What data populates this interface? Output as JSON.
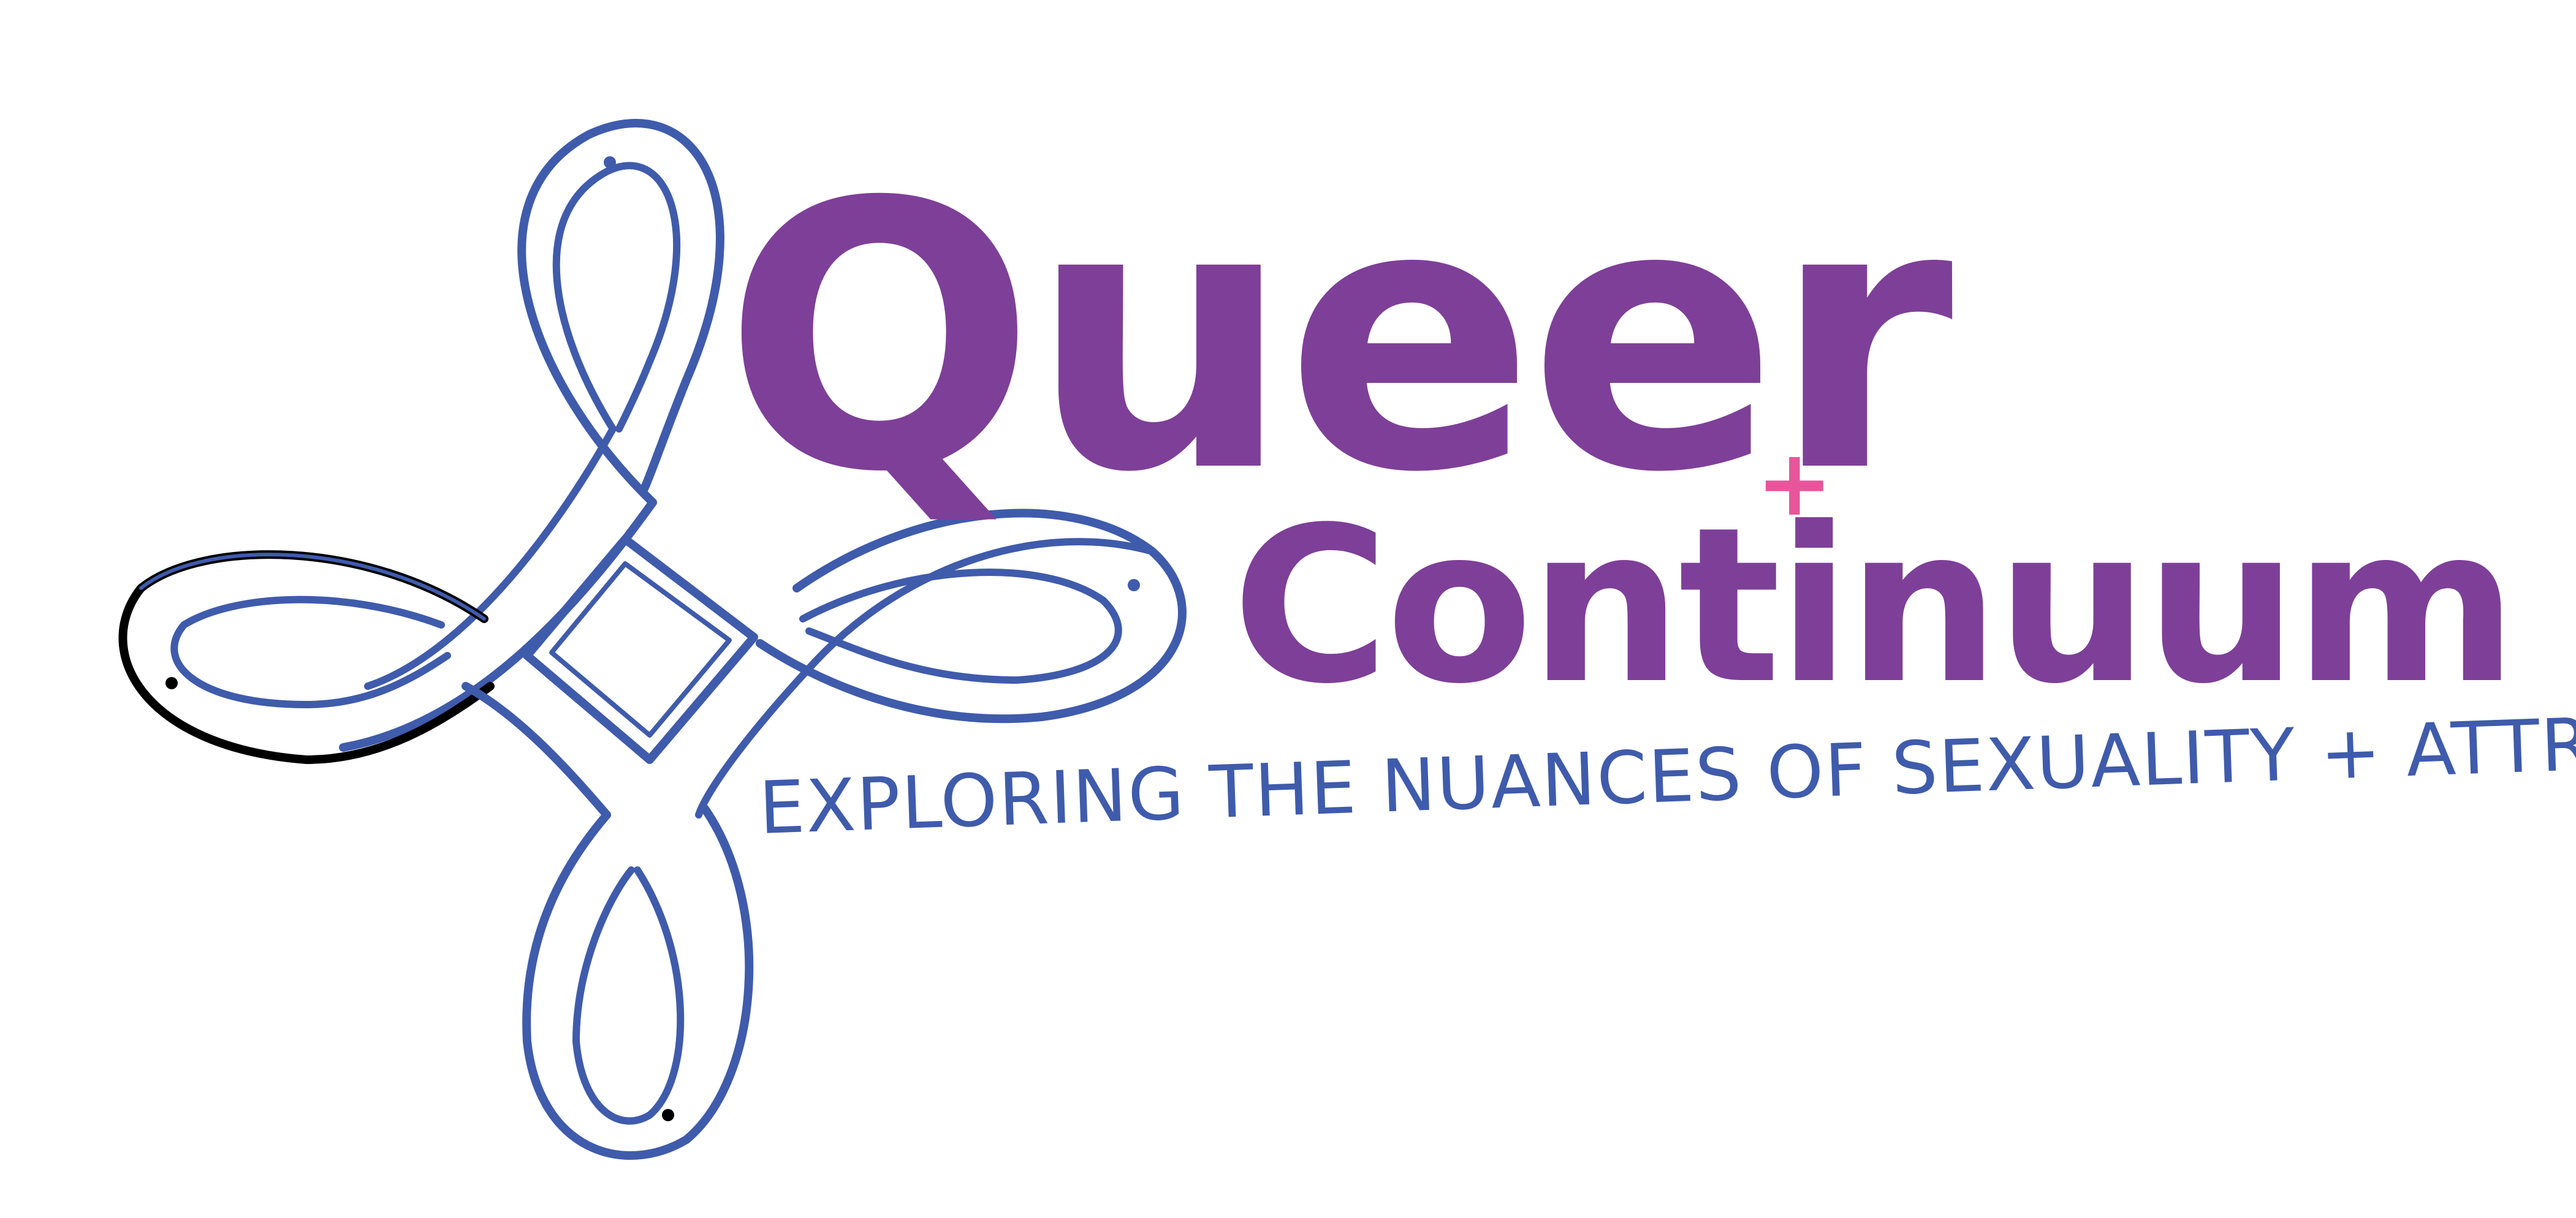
{
  "logo": {
    "word_queer": "Queer",
    "plus_sign": "+",
    "word_continuum": "Continuum",
    "tagline": "EXPLORING THE NUANCES OF SEXUALITY + ATTRACTION"
  },
  "colors": {
    "purple": "#7e3f98",
    "pink": "#e8559b",
    "blue": "#3f5bab",
    "black": "#000000",
    "background": "#ffffff"
  },
  "icons": {
    "emblem": "celtic-knot-serpent-icon"
  }
}
